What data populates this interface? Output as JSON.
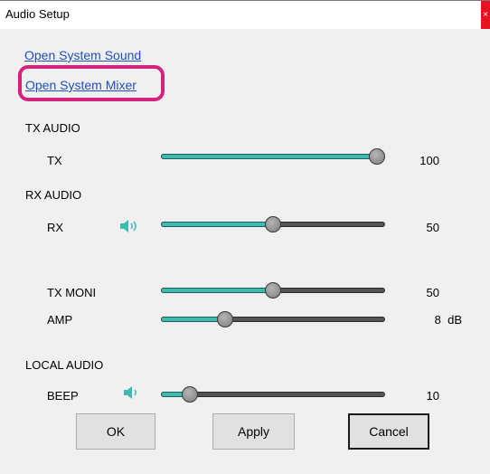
{
  "window": {
    "title": "Audio Setup",
    "close_glyph": "×"
  },
  "links": {
    "open_system_sound": "Open System Sound",
    "open_system_mixer": "Open System Mixer"
  },
  "sections": {
    "tx_audio": "TX AUDIO",
    "rx_audio": "RX AUDIO",
    "local_audio": "LOCAL AUDIO"
  },
  "sliders": {
    "tx": {
      "label": "TX",
      "value": 100,
      "display": "100",
      "fraction": 1.0
    },
    "rx": {
      "label": "RX",
      "value": 50,
      "display": "50",
      "fraction": 0.5,
      "icon": "speaker-icon"
    },
    "tx_moni": {
      "label": "TX MONI",
      "value": 50,
      "display": "50",
      "fraction": 0.5
    },
    "amp": {
      "label": "AMP",
      "value": 8,
      "display": "8  dB",
      "fraction": 0.27
    },
    "beep": {
      "label": "BEEP",
      "value": 10,
      "display": "10",
      "fraction": 0.1,
      "icon": "speaker-icon"
    }
  },
  "buttons": {
    "ok": "OK",
    "apply": "Apply",
    "cancel": "Cancel"
  },
  "colors": {
    "accent_teal": "#3fbab3",
    "highlight_magenta": "#d4237f",
    "link_blue": "#1f4fbf",
    "close_red": "#e81123"
  }
}
